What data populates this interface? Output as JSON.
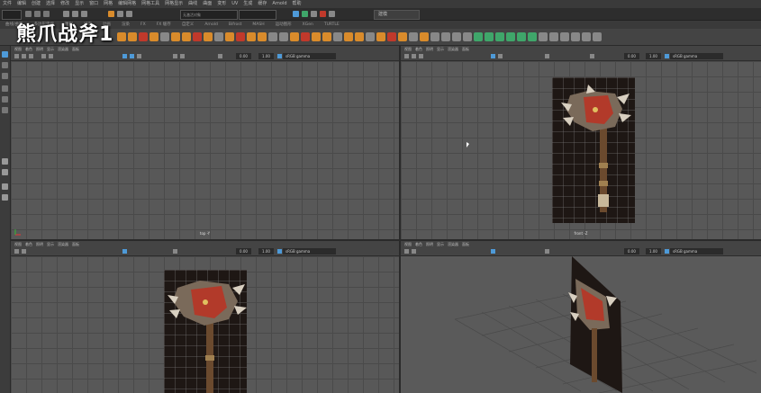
{
  "overlay": {
    "title": "熊爪战斧1"
  },
  "menubar": {
    "items": [
      "文件",
      "编辑",
      "创建",
      "选择",
      "修改",
      "显示",
      "窗口",
      "网格",
      "编辑网格",
      "网格工具",
      "网格显示",
      "曲线",
      "曲面",
      "变形",
      "UV",
      "生成",
      "缓存",
      "Arnold",
      "帮助"
    ]
  },
  "status": {
    "workspace": "建模",
    "field_text": "无激活对象"
  },
  "shelf": {
    "tabs": [
      "曲线/曲面",
      "多边形建模",
      "雕刻",
      "绑定",
      "动画",
      "渲染",
      "FX",
      "FX 缓存",
      "自定义",
      "Arnold",
      "Bifrost",
      "MASH",
      "运动图形",
      "XGen",
      "TURTLE"
    ]
  },
  "viewports": [
    {
      "id": "top",
      "menu": [
        "视图",
        "着色",
        "照明",
        "显示",
        "渲染器",
        "面板"
      ],
      "num1": "0.00",
      "num2": "1.00",
      "colorspace": "sRGB gamma",
      "label": "top -Y",
      "has_image": false
    },
    {
      "id": "front",
      "menu": [
        "视图",
        "着色",
        "照明",
        "显示",
        "渲染器",
        "面板"
      ],
      "num1": "0.00",
      "num2": "1.00",
      "colorspace": "sRGB gamma",
      "label": "front -Z",
      "has_image": true
    },
    {
      "id": "side",
      "menu": [
        "视图",
        "着色",
        "照明",
        "显示",
        "渲染器",
        "面板"
      ],
      "num1": "0.00",
      "num2": "1.00",
      "colorspace": "sRGB gamma",
      "label": "",
      "has_image": true
    },
    {
      "id": "persp",
      "menu": [
        "视图",
        "着色",
        "照明",
        "显示",
        "渲染器",
        "面板"
      ],
      "num1": "0.00",
      "num2": "1.00",
      "colorspace": "sRGB gamma",
      "label": "",
      "has_image": true
    }
  ],
  "colors": {
    "accent": "#4e9ad8",
    "shelf_orange": "#d98b2b",
    "shelf_green": "#3fa66a",
    "axe_red": "#c0392b"
  }
}
